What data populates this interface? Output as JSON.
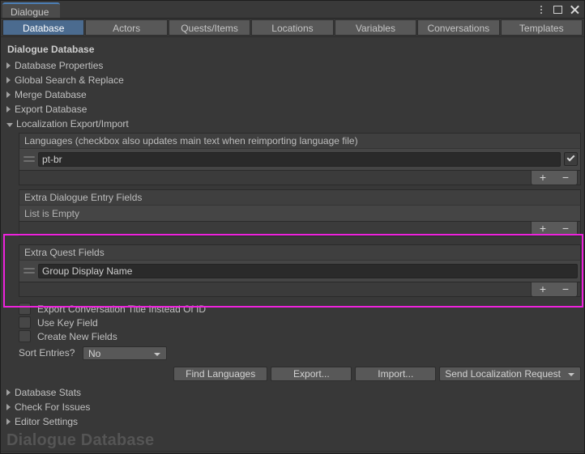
{
  "window": {
    "tab_label": "Dialogue",
    "controls": {
      "kebab": "more-options",
      "maximize": "maximize",
      "close": "close"
    }
  },
  "tabs": [
    {
      "label": "Database",
      "active": true
    },
    {
      "label": "Actors",
      "active": false
    },
    {
      "label": "Quests/Items",
      "active": false
    },
    {
      "label": "Locations",
      "active": false
    },
    {
      "label": "Variables",
      "active": false
    },
    {
      "label": "Conversations",
      "active": false
    },
    {
      "label": "Templates",
      "active": false
    }
  ],
  "main": {
    "heading": "Dialogue Database",
    "foldouts": [
      {
        "label": "Database Properties",
        "open": false
      },
      {
        "label": "Global Search & Replace",
        "open": false
      },
      {
        "label": "Merge Database",
        "open": false
      },
      {
        "label": "Export Database",
        "open": false
      },
      {
        "label": "Localization Export/Import",
        "open": true
      }
    ],
    "languages": {
      "header": "Languages (checkbox also updates main text when reimporting language file)",
      "items": [
        {
          "value": "pt-br",
          "checked": true
        }
      ],
      "add_label": "+",
      "remove_label": "−"
    },
    "extra_dialogue_entry_fields": {
      "header": "Extra Dialogue Entry Fields",
      "empty_label": "List is Empty",
      "add_label": "+",
      "remove_label": "−"
    },
    "extra_quest_fields": {
      "header": "Extra Quest Fields",
      "items": [
        {
          "value": "Group Display Name"
        }
      ],
      "add_label": "+",
      "remove_label": "−",
      "highlight_color": "#ee22dd"
    },
    "options": [
      {
        "label": "Export Conversation Title Instead Of ID",
        "checked": false
      },
      {
        "label": "Use Key Field",
        "checked": false
      },
      {
        "label": "Create New Fields",
        "checked": false
      }
    ],
    "sort_entries": {
      "label": "Sort Entries?",
      "value": "No"
    },
    "actions": {
      "find_languages": "Find Languages",
      "export": "Export...",
      "import": "Import...",
      "send_localization_request": "Send Localization Request"
    },
    "bottom_foldouts": [
      {
        "label": "Database Stats",
        "open": false
      },
      {
        "label": "Check For Issues",
        "open": false
      },
      {
        "label": "Editor Settings",
        "open": false
      }
    ],
    "watermark": "Dialogue Database"
  }
}
